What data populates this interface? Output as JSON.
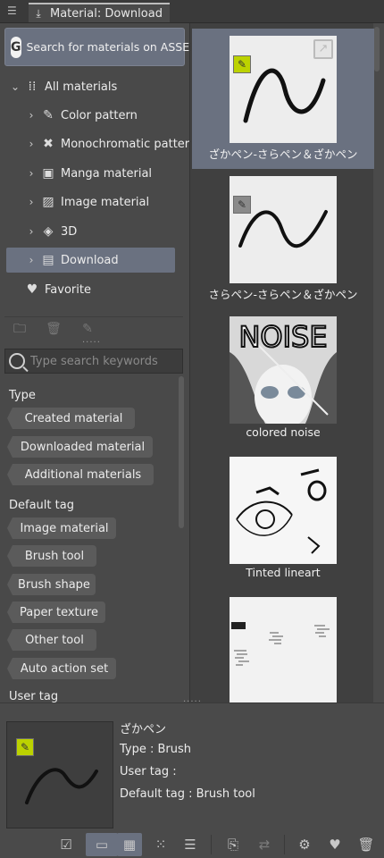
{
  "window": {
    "tab_title": "Material: Download"
  },
  "assets_search": {
    "label": "Search for materials on ASSETS"
  },
  "tree": [
    {
      "label": "All materials",
      "icon": "grid-dots-icon"
    },
    {
      "label": "Color pattern",
      "icon": "color-pattern-icon"
    },
    {
      "label": "Monochromatic pattern",
      "icon": "mono-pattern-icon"
    },
    {
      "label": "Manga material",
      "icon": "manga-icon"
    },
    {
      "label": "Image material",
      "icon": "image-icon"
    },
    {
      "label": "3D",
      "icon": "cube-icon"
    },
    {
      "label": "Download",
      "icon": "download-folder-icon",
      "selected": true
    },
    {
      "label": "Favorite",
      "icon": "heart-icon"
    }
  ],
  "keyword_search": {
    "placeholder": "Type search keywords"
  },
  "type_section": {
    "label": "Type",
    "tags": [
      "Created material",
      "Downloaded material",
      "Additional materials"
    ]
  },
  "default_tag_section": {
    "label": "Default tag",
    "tags": [
      "Image material",
      "Brush tool",
      "Brush shape",
      "Paper texture",
      "Other tool",
      "Auto action set"
    ]
  },
  "user_tag_section": {
    "label": "User tag"
  },
  "materials": [
    {
      "name": "ざかペン-さらペン＆ざかペン",
      "selected": true,
      "badge": "brush"
    },
    {
      "name": "さらペン-さらペン＆ざかペン",
      "selected": false,
      "badge": "brush-grey"
    },
    {
      "name": "colored noise",
      "selected": false,
      "badge": "none"
    },
    {
      "name": "Tinted lineart",
      "selected": false,
      "badge": "none"
    },
    {
      "name": "",
      "selected": false,
      "badge": "none"
    }
  ],
  "noise_text": "NOISE",
  "detail": {
    "name": "ざかペン",
    "type": "Type : Brush",
    "user_tag": "User tag :",
    "default_tag": "Default tag : Brush tool"
  },
  "colors": {
    "selection": "#6a7180",
    "panel": "#494949",
    "brush_badge": "#bcd200"
  }
}
